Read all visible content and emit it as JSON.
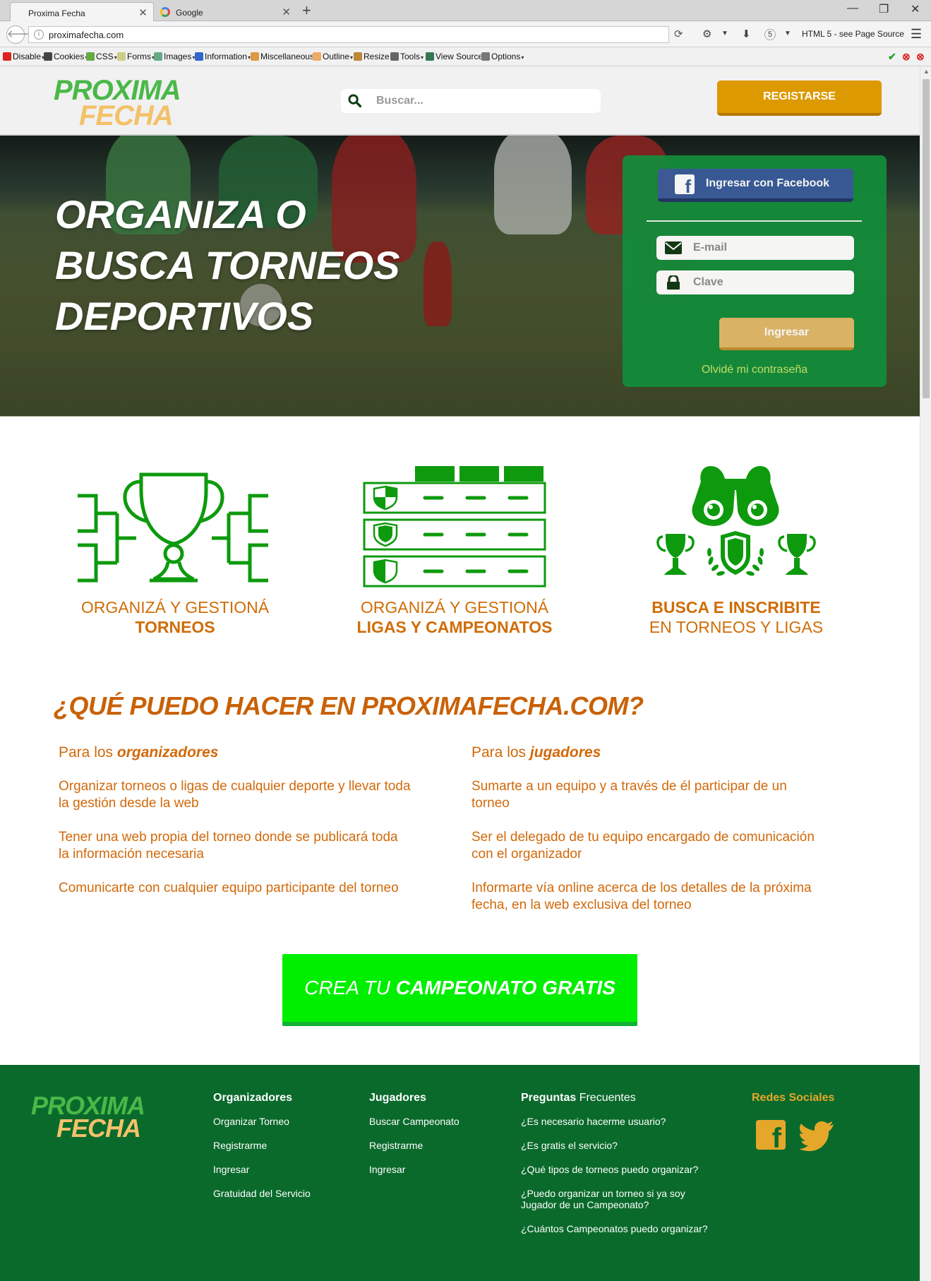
{
  "browser": {
    "tabs": [
      {
        "label": "Proxima Fecha",
        "active": true
      },
      {
        "label": "Google",
        "active": false
      }
    ],
    "url": "proximafecha.com",
    "html5_label": "HTML 5 - see Page Source",
    "toolbar": [
      "Disable",
      "Cookies",
      "CSS",
      "Forms",
      "Images",
      "Information",
      "Miscellaneous",
      "Outline",
      "Resize",
      "Tools",
      "View Source",
      "Options"
    ]
  },
  "header": {
    "logo_line1": "PROXIMA",
    "logo_line2": "FECHA",
    "search_placeholder": "Buscar...",
    "register_label": "REGISTARSE"
  },
  "hero": {
    "title_lines": [
      "ORGANIZA O",
      "BUSCA TORNEOS",
      "DEPORTIVOS"
    ]
  },
  "login": {
    "facebook_label": "Ingresar con Facebook",
    "email_placeholder": "E-mail",
    "password_placeholder": "Clave",
    "submit_label": "Ingresar",
    "forgot_label": "Olvidé mi contraseña"
  },
  "features": [
    {
      "line1": "ORGANIZÁ Y GESTIONÁ",
      "line2": "TORNEOS",
      "bold_line": 2,
      "icon": "tournament-bracket-icon"
    },
    {
      "line1": "ORGANIZÁ Y GESTIONÁ",
      "line2": "LIGAS Y CAMPEONATOS",
      "bold_line": 2,
      "icon": "league-table-icon"
    },
    {
      "line1": "BUSCA E INSCRIBITE",
      "line2": "EN TORNEOS Y LIGAS",
      "bold_line": 1,
      "icon": "binoculars-trophies-icon"
    }
  ],
  "what": {
    "title": "¿QUÉ PUEDO HACER EN PROXIMAFECHA.COM?",
    "organizers": {
      "prefix": "Para los",
      "emphasis": "organizadores",
      "items": [
        "Organizar torneos o ligas de cualquier deporte y llevar toda la gestión desde la web",
        "Tener una web propia del torneo donde se publicará toda la información necesaria",
        "Comunicarte con cualquier equipo participante del torneo"
      ]
    },
    "players": {
      "prefix": "Para los",
      "emphasis": "jugadores",
      "items": [
        "Sumarte a un equipo y a través de él participar de un torneo",
        "Ser el delegado de tu equipo encargado de comunicación con el organizador",
        "Informarte vía online acerca de los detalles de la próxima fecha, en la web exclusiva del torneo"
      ]
    }
  },
  "cta": {
    "normal": "CREA TU",
    "bold": "CAMPEONATO GRATIS"
  },
  "footer": {
    "logo_line1": "PROXIMA",
    "logo_line2": "FECHA",
    "organizers": {
      "title": "Organizadores",
      "links": [
        "Organizar Torneo",
        "Registrarme",
        "Ingresar",
        "Gratuidad del Servicio"
      ]
    },
    "players": {
      "title": "Jugadores",
      "links": [
        "Buscar Campeonato",
        "Registrarme",
        "Ingresar"
      ]
    },
    "faq": {
      "title_bold": "Preguntas",
      "title_normal": "Frecuentes",
      "links": [
        "¿Es necesario hacerme usuario?",
        "¿Es gratis el servicio?",
        "¿Qué tipos de torneos puedo organizar?",
        "¿Puedo organizar un torneo si ya soy Jugador de un Campeonato?",
        "¿Cuántos Campeonatos puedo organizar?"
      ]
    },
    "social": {
      "title": "Redes Sociales",
      "icons": [
        "facebook-icon",
        "twitter-icon"
      ]
    }
  },
  "colors": {
    "brand_green": "#138b3a",
    "logo_green": "#4ab848",
    "logo_yellow": "#f3c16a",
    "accent_orange": "#dd9900",
    "text_orange": "#d06d07",
    "icon_green": "#0d9a0d",
    "cta_green": "#00ee00",
    "footer_green": "#0a6a2c",
    "facebook_blue": "#3a5b9a"
  }
}
